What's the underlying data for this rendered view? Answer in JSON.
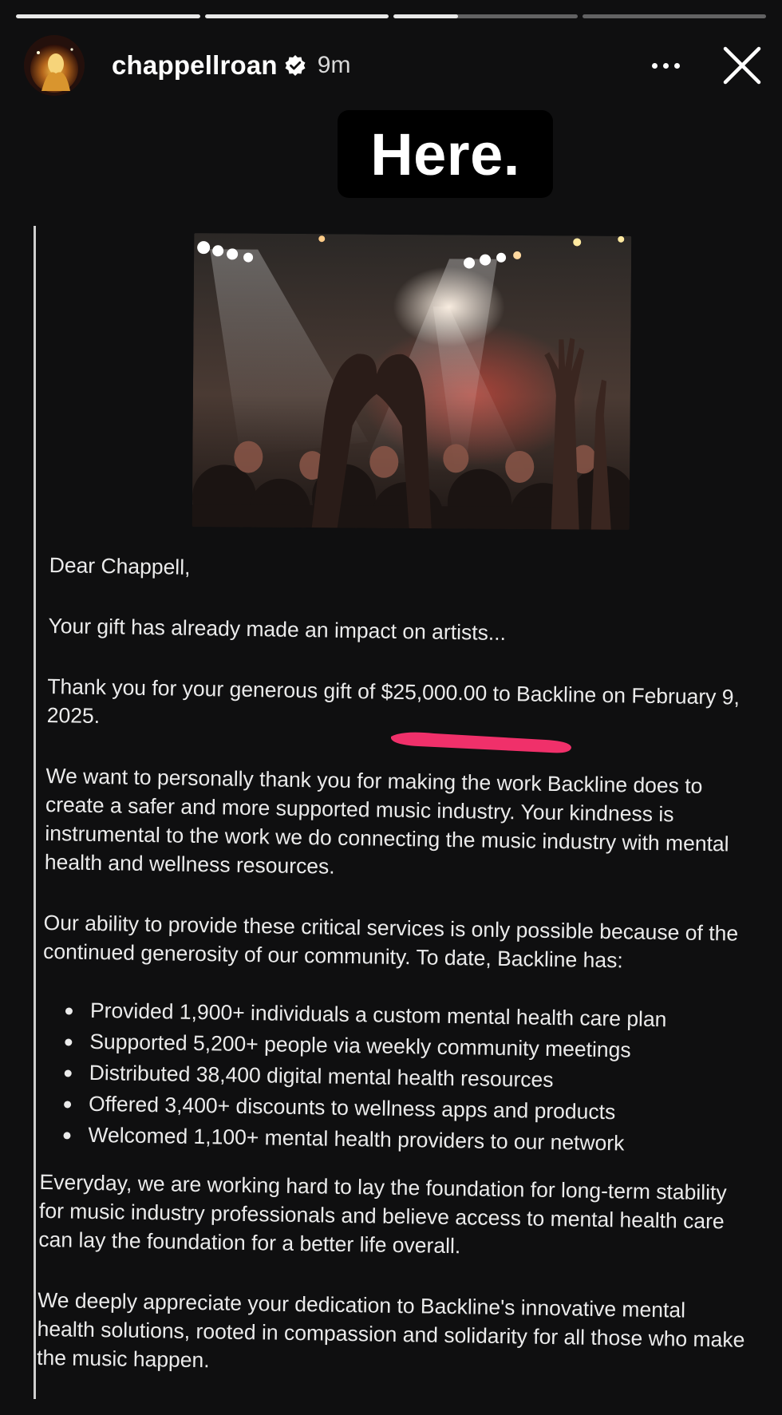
{
  "story": {
    "progress": [
      1,
      1,
      0.35,
      0
    ],
    "username": "chappellroan",
    "time": "9m",
    "sticker_text": "Here."
  },
  "icons": {
    "verified": "verified-badge-icon",
    "more": "more-options-icon",
    "close": "close-icon"
  },
  "letter": {
    "greeting": "Dear Chappell,",
    "intro": "Your gift has already made an impact on artists...",
    "thanks": "Thank you for your generous gift of $25,000.00 to Backline on February 9, 2025.",
    "para1": "We want to personally thank you for making the work Backline does to create a safer and more supported music industry. Your kindness is instrumental to the work we do connecting the music industry with mental health and wellness resources.",
    "para2": "Our ability to provide these critical services is only possible because of the continued generosity of our community. To date, Backline has:",
    "bullets": [
      "Provided 1,900+ individuals a custom mental health care plan",
      "Supported 5,200+ people via weekly community meetings",
      "Distributed 38,400 digital mental health resources",
      "Offered 3,400+ discounts to wellness apps and products",
      "Welcomed 1,100+ mental health providers to our network"
    ],
    "para3": "Everyday, we are working hard to lay the foundation for long-term stability for music industry professionals and believe access to mental health care can lay the foundation for a better life overall.",
    "para4": "We deeply appreciate your dedication to Backline's innovative mental health solutions, rooted in compassion and solidarity for all those who make the music happen."
  },
  "colors": {
    "background": "#0f0f10",
    "underline": "#f0306a",
    "text": "#ebebeb"
  }
}
